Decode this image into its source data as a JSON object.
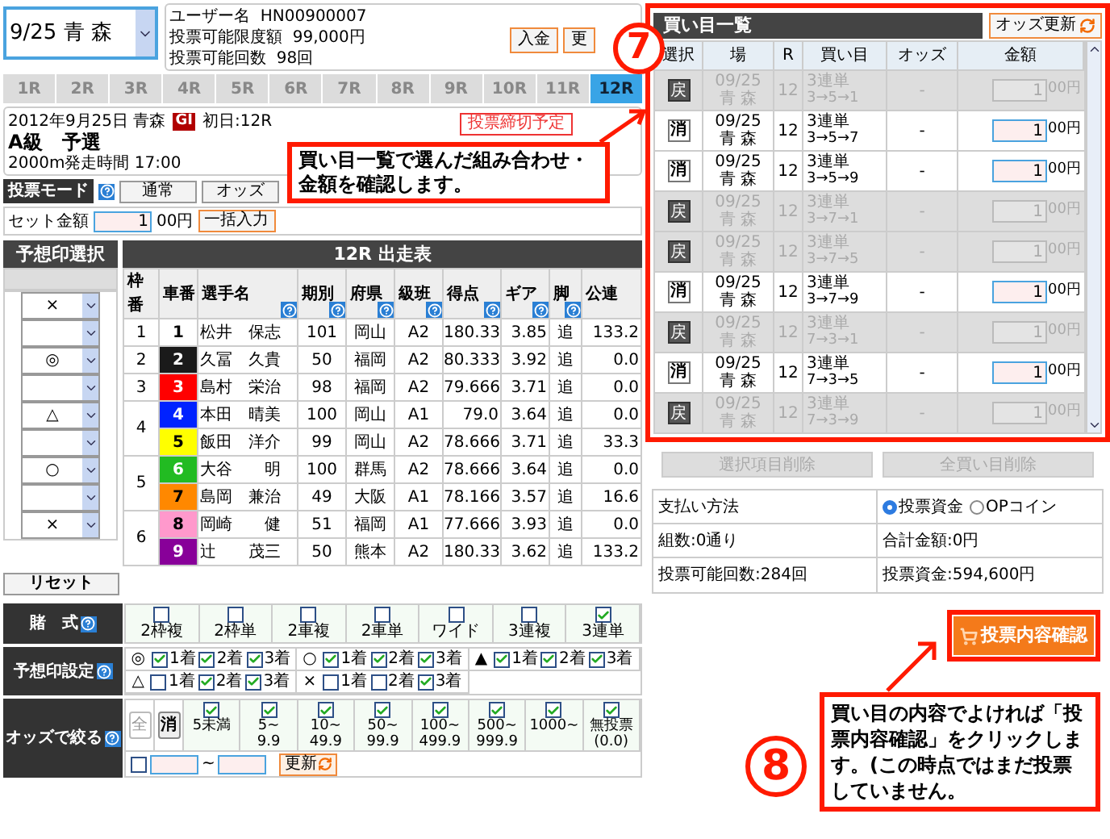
{
  "venue_select": {
    "value": "9/25 青 森"
  },
  "user_info": {
    "lines": [
      "ユーザー名  HN00900007",
      "投票可能限度額  99,000円",
      "投票可能回数  98回"
    ],
    "buttons": [
      "入金",
      "更"
    ]
  },
  "race_tabs": [
    {
      "label": "1R",
      "selected": false
    },
    {
      "label": "2R",
      "selected": false
    },
    {
      "label": "3R",
      "selected": false
    },
    {
      "label": "4R",
      "selected": false
    },
    {
      "label": "5R",
      "selected": false
    },
    {
      "label": "6R",
      "selected": false
    },
    {
      "label": "7R",
      "selected": false
    },
    {
      "label": "8R",
      "selected": false
    },
    {
      "label": "9R",
      "selected": false
    },
    {
      "label": "10R",
      "selected": false
    },
    {
      "label": "11R",
      "selected": false
    },
    {
      "label": "12R",
      "selected": true
    }
  ],
  "race_info": {
    "date": "2012年9月25日 青森",
    "grade": "GI",
    "day": "初日:12R",
    "title": "A級　予選",
    "detail": "2000m発走時間 17:00",
    "deadline": "投票締切予定"
  },
  "mode": {
    "label": "投票モード",
    "buttons": [
      "通常",
      "オッズ"
    ]
  },
  "set_amount": {
    "label": "セット金額",
    "value": "1",
    "unit": "00円",
    "button": "一括入力"
  },
  "marks": {
    "title": "予想印選択",
    "selects": [
      {
        "kind": "marked",
        "mark": "×"
      },
      {
        "kind": "empty"
      },
      {
        "kind": "marked",
        "mark": "◎"
      },
      {
        "kind": "empty"
      },
      {
        "kind": "marked",
        "mark": "△"
      },
      {
        "kind": "empty"
      },
      {
        "kind": "marked",
        "mark": "○"
      },
      {
        "kind": "empty"
      },
      {
        "kind": "marked",
        "mark": "×"
      }
    ]
  },
  "entry_table": {
    "title": "12R 出走表",
    "columns": [
      {
        "label": "枠番",
        "help": false
      },
      {
        "label": "車番",
        "help": false
      },
      {
        "label": "選手名",
        "help": true
      },
      {
        "label": "期別",
        "help": true
      },
      {
        "label": "府県",
        "help": true
      },
      {
        "label": "級班",
        "help": true
      },
      {
        "label": "得点",
        "help": true
      },
      {
        "label": "ギア",
        "help": true
      },
      {
        "label": "脚",
        "help": true
      },
      {
        "label": "公連",
        "help": false
      }
    ],
    "groups": [
      {
        "waku": "1",
        "rows": [
          {
            "car": "1",
            "color": "#ffffff",
            "name": "松井　保志",
            "period": "101",
            "pref": "岡山",
            "class": "A2",
            "score": "180.33",
            "gear": "3.85",
            "leg": "追",
            "odds": "133.2"
          }
        ]
      },
      {
        "waku": "2",
        "rows": [
          {
            "car": "2",
            "color": "#1a1a1a",
            "name": "久冨　久貴",
            "period": "50",
            "pref": "福岡",
            "class": "A2",
            "score": "80.333",
            "gear": "3.92",
            "leg": "追",
            "odds": "0.0"
          }
        ]
      },
      {
        "waku": "3",
        "rows": [
          {
            "car": "3",
            "color": "#ff0000",
            "name": "島村　栄治",
            "period": "98",
            "pref": "福岡",
            "class": "A2",
            "score": "79.666",
            "gear": "3.71",
            "leg": "追",
            "odds": "0.0"
          }
        ]
      },
      {
        "waku": "4",
        "rows": [
          {
            "car": "4",
            "color": "#0022ff",
            "name": "本田　晴美",
            "period": "100",
            "pref": "岡山",
            "class": "A1",
            "score": "79.0",
            "gear": "3.64",
            "leg": "追",
            "odds": "0.0"
          },
          {
            "car": "5",
            "color": "#ffff00",
            "name": "飯田　洋介",
            "period": "99",
            "pref": "岡山",
            "class": "A2",
            "score": "78.666",
            "gear": "3.71",
            "leg": "追",
            "odds": "33.3"
          }
        ]
      },
      {
        "waku": "5",
        "rows": [
          {
            "car": "6",
            "color": "#22bb22",
            "name": "大谷　　明",
            "period": "100",
            "pref": "群馬",
            "class": "A2",
            "score": "78.666",
            "gear": "3.64",
            "leg": "追",
            "odds": "0.0"
          },
          {
            "car": "7",
            "color": "#ff8800",
            "name": "島岡　兼治",
            "period": "49",
            "pref": "大阪",
            "class": "A1",
            "score": "78.166",
            "gear": "3.57",
            "leg": "追",
            "odds": "16.6"
          }
        ]
      },
      {
        "waku": "6",
        "rows": [
          {
            "car": "8",
            "color": "#ff99cc",
            "name": "岡崎　　健",
            "period": "51",
            "pref": "福岡",
            "class": "A1",
            "score": "77.666",
            "gear": "3.93",
            "leg": "追",
            "odds": "0.0"
          },
          {
            "car": "9",
            "color": "#880099",
            "name": "辻　　茂三",
            "period": "50",
            "pref": "熊本",
            "class": "A2",
            "score": "180.33",
            "gear": "3.62",
            "leg": "追",
            "odds": "133.2"
          }
        ]
      }
    ]
  },
  "reset_button": "リセット",
  "bet_types": {
    "label": "賭　式",
    "items": [
      {
        "label": "2枠複",
        "checked": false
      },
      {
        "label": "2枠単",
        "checked": false
      },
      {
        "label": "2車複",
        "checked": false
      },
      {
        "label": "2車単",
        "checked": false
      },
      {
        "label": "ワイド",
        "checked": false
      },
      {
        "label": "3連複",
        "checked": false
      },
      {
        "label": "3連単",
        "checked": true
      }
    ]
  },
  "prediction_settings": {
    "label": "予想印設定",
    "groups": [
      {
        "mark": "◎",
        "places": [
          {
            "label": "1着",
            "checked": true
          },
          {
            "label": "2着",
            "checked": true
          },
          {
            "label": "3着",
            "checked": true
          }
        ]
      },
      {
        "mark": "○",
        "places": [
          {
            "label": "1着",
            "checked": true
          },
          {
            "label": "2着",
            "checked": true
          },
          {
            "label": "3着",
            "checked": true
          }
        ]
      },
      {
        "mark": "▲",
        "places": [
          {
            "label": "1着",
            "checked": true
          },
          {
            "label": "2着",
            "checked": true
          },
          {
            "label": "3着",
            "checked": true
          }
        ]
      },
      {
        "mark": "△",
        "places": [
          {
            "label": "1着",
            "checked": false
          },
          {
            "label": "2着",
            "checked": true
          },
          {
            "label": "3着",
            "checked": true
          }
        ]
      },
      {
        "mark": "×",
        "places": [
          {
            "label": "1着",
            "checked": false
          },
          {
            "label": "2着",
            "checked": false
          },
          {
            "label": "3着",
            "checked": true
          }
        ]
      }
    ]
  },
  "odds_filter": {
    "label": "オッズで絞る",
    "all_button": "全",
    "clear_button": "消",
    "ranges": [
      {
        "lines": [
          "5未満"
        ],
        "checked": true
      },
      {
        "lines": [
          "5~",
          "9.9"
        ],
        "checked": true
      },
      {
        "lines": [
          "10~",
          "49.9"
        ],
        "checked": true
      },
      {
        "lines": [
          "50~",
          "99.9"
        ],
        "checked": true
      },
      {
        "lines": [
          "100~",
          "499.9"
        ],
        "checked": true
      },
      {
        "lines": [
          "500~",
          "999.9"
        ],
        "checked": true
      },
      {
        "lines": [
          "1000~"
        ],
        "checked": true
      },
      {
        "lines": [
          "無投票",
          "(0.0)"
        ],
        "checked": true
      }
    ],
    "custom": {
      "checked": false,
      "separator": "~",
      "button": "更新"
    }
  },
  "buy_list": {
    "title": "買い目一覧",
    "refresh_button": "オッズ更新",
    "columns": [
      "選択",
      "場",
      "R",
      "買い目",
      "オッズ",
      "金額"
    ],
    "rows": [
      {
        "removed": true,
        "action": "戻",
        "date": "09/25",
        "venue": "青 森",
        "r": "12",
        "type": "3連単",
        "combo": "3→5→1",
        "odds": "-",
        "amount": "1",
        "unit": "00円"
      },
      {
        "removed": false,
        "action": "消",
        "date": "09/25",
        "venue": "青 森",
        "r": "12",
        "type": "3連単",
        "combo": "3→5→7",
        "odds": "-",
        "amount": "1",
        "unit": "00円"
      },
      {
        "removed": false,
        "action": "消",
        "date": "09/25",
        "venue": "青 森",
        "r": "12",
        "type": "3連単",
        "combo": "3→5→9",
        "odds": "-",
        "amount": "1",
        "unit": "00円"
      },
      {
        "removed": true,
        "action": "戻",
        "date": "09/25",
        "venue": "青 森",
        "r": "12",
        "type": "3連単",
        "combo": "3→7→1",
        "odds": "-",
        "amount": "1",
        "unit": "00円"
      },
      {
        "removed": true,
        "action": "戻",
        "date": "09/25",
        "venue": "青 森",
        "r": "12",
        "type": "3連単",
        "combo": "3→7→5",
        "odds": "-",
        "amount": "1",
        "unit": "00円"
      },
      {
        "removed": false,
        "action": "消",
        "date": "09/25",
        "venue": "青 森",
        "r": "12",
        "type": "3連単",
        "combo": "3→7→9",
        "odds": "-",
        "amount": "1",
        "unit": "00円"
      },
      {
        "removed": true,
        "action": "戻",
        "date": "09/25",
        "venue": "青 森",
        "r": "12",
        "type": "3連単",
        "combo": "7→3→1",
        "odds": "-",
        "amount": "1",
        "unit": "00円"
      },
      {
        "removed": false,
        "action": "消",
        "date": "09/25",
        "venue": "青 森",
        "r": "12",
        "type": "3連単",
        "combo": "7→3→5",
        "odds": "-",
        "amount": "1",
        "unit": "00円"
      },
      {
        "removed": true,
        "action": "戻",
        "date": "09/25",
        "venue": "青 森",
        "r": "12",
        "type": "3連単",
        "combo": "7→3→9",
        "odds": "-",
        "amount": "1",
        "unit": "00円"
      }
    ],
    "buttons": [
      {
        "label": "選択項目削除",
        "disabled": true
      },
      {
        "label": "全買い目削除",
        "disabled": true
      }
    ]
  },
  "payment": {
    "label": "支払い方法",
    "options": [
      {
        "label": "投票資金",
        "selected": true
      },
      {
        "label": "OPコイン",
        "selected": false
      }
    ],
    "summary": [
      "組数:0通り",
      "合計金額:0円",
      "投票可能回数:284回",
      "投票資金:594,600円"
    ]
  },
  "confirm_button": "投票内容確認",
  "annotations": [
    {
      "number": "7",
      "text": "買い目一覧で選んだ組み合わせ・金額を確認します。"
    },
    {
      "number": "8",
      "text": "買い目の内容でよければ「投票内容確認」をクリックします。(この時点ではまだ投票していません。"
    }
  ]
}
